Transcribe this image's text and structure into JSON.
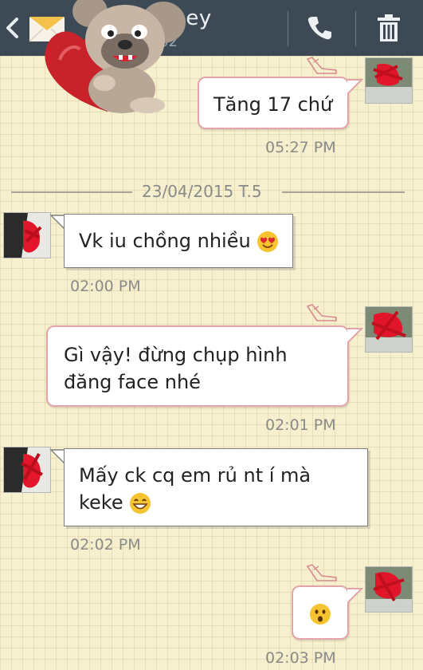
{
  "header": {
    "contact_name": "oney",
    "contact_sub": "02",
    "icons": [
      "back-arrow-icon",
      "envelope-icon",
      "phone-icon",
      "trash-icon"
    ]
  },
  "messages": [
    {
      "direction": "outgoing",
      "text": "Tăng 17 chứ",
      "time": "05:27 PM"
    },
    {
      "direction": "incoming",
      "text": "Vk iu chồng nhiều",
      "emoji": "heart-eyes-emoji",
      "time": "02:00 PM"
    },
    {
      "direction": "outgoing",
      "line1": "Gì vậy! đừng chụp hình",
      "line2": "đăng face nhé",
      "time": "02:01 PM"
    },
    {
      "direction": "incoming",
      "line1": "Mấy ck cq em rủ nt í mà",
      "line2": "keke",
      "emoji": "grinning-emoji",
      "time": "02:02 PM"
    },
    {
      "direction": "outgoing",
      "emoji": "surprised-emoji",
      "time": "02:03 PM"
    }
  ],
  "date_separator": "23/04/2015 T.5",
  "colors": {
    "header_bg": "#3d4a55",
    "background": "#f7f0cf",
    "outgoing_border": "#e2a4a9",
    "incoming_border": "#7f7f7f",
    "timestamp": "#8a8a8a"
  }
}
